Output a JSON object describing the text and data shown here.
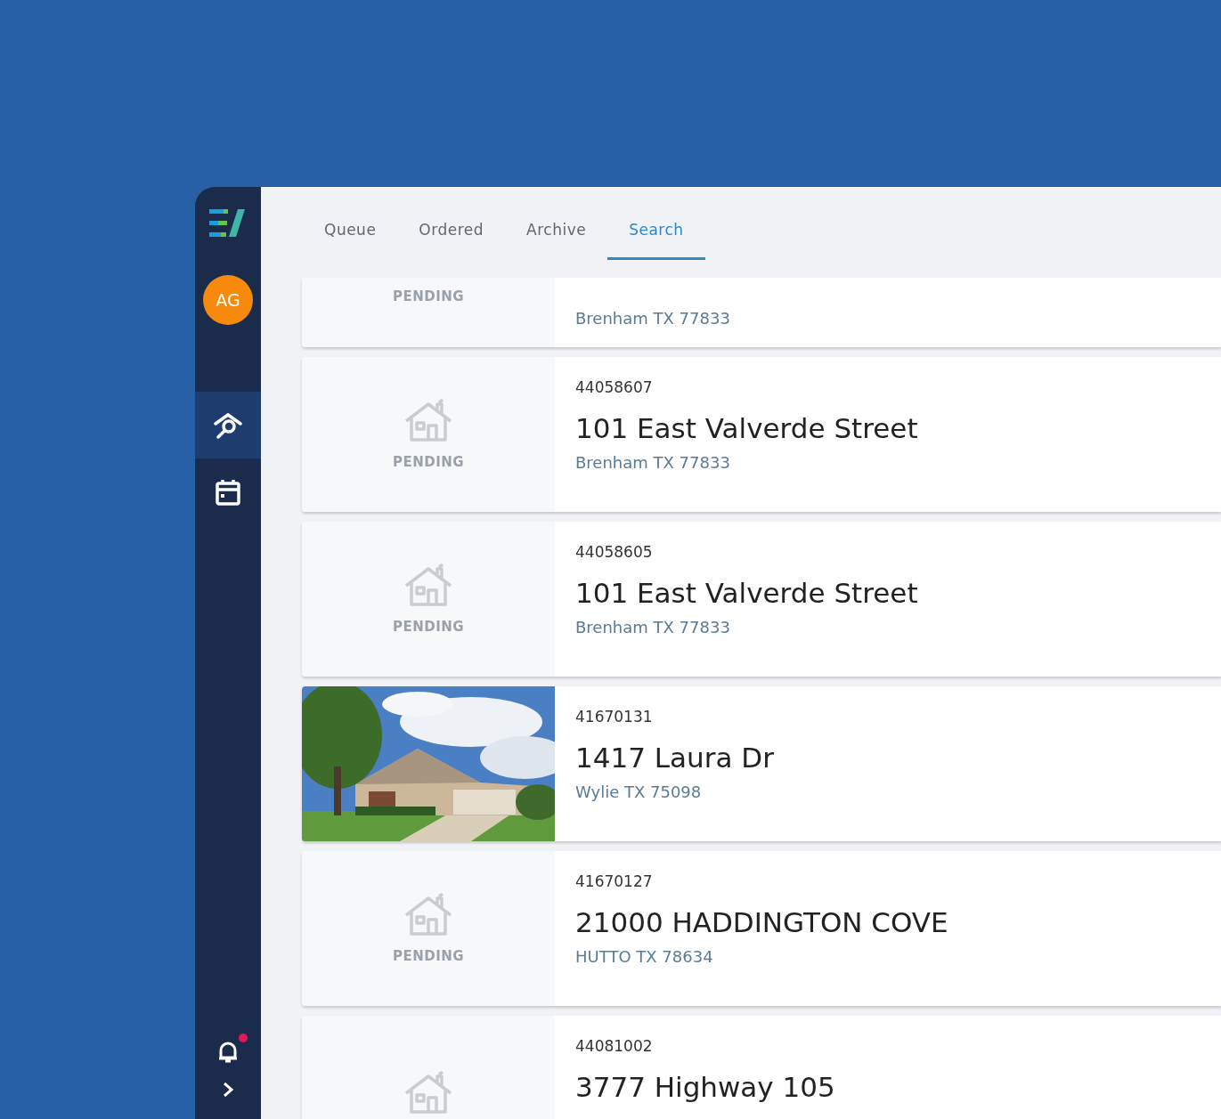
{
  "sidebar": {
    "avatar": "AG",
    "items": [
      {
        "kind": "search-home",
        "selected": true
      },
      {
        "kind": "calendar",
        "selected": false
      }
    ],
    "notifications": {
      "unread": true
    }
  },
  "tabs": [
    {
      "label": "Queue",
      "selected": false
    },
    {
      "label": "Ordered",
      "selected": false
    },
    {
      "label": "Archive",
      "selected": false
    },
    {
      "label": "Search",
      "selected": true
    }
  ],
  "results": [
    {
      "cut_top": true,
      "kind": "pending",
      "status": "PENDING",
      "city": "Brenham TX 77833"
    },
    {
      "kind": "pending",
      "status": "PENDING",
      "number": "44058607",
      "address": "101 East Valverde Street",
      "city": "Brenham TX 77833"
    },
    {
      "kind": "pending",
      "status": "PENDING",
      "number": "44058605",
      "address": "101 East Valverde Street",
      "city": "Brenham TX 77833"
    },
    {
      "kind": "picture",
      "number": "41670131",
      "address": "1417 Laura Dr",
      "city": "Wylie TX 75098"
    },
    {
      "kind": "pending",
      "status": "PENDING",
      "number": "41670127",
      "address": "21000 HADDINGTON COVE",
      "city": "HUTTO TX 78634"
    },
    {
      "kind": "pending",
      "number": "44081002",
      "address": "3777 Highway 105"
    }
  ]
}
